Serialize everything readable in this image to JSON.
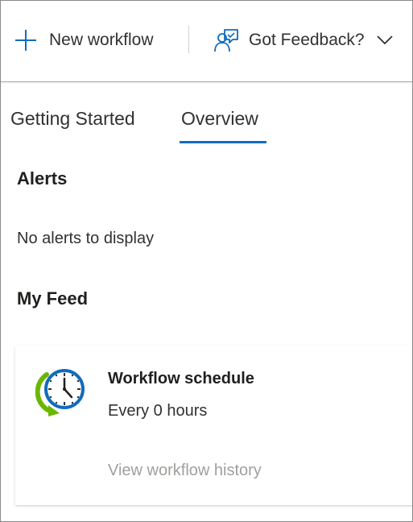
{
  "toolbar": {
    "new_workflow_label": "New workflow",
    "new_workflow_icon": "plus-icon",
    "feedback_label": "Got Feedback?",
    "feedback_icon": "feedback-person-icon",
    "feedback_chevron_icon": "chevron-down-icon"
  },
  "tabs": [
    {
      "label": "Getting Started",
      "selected": false
    },
    {
      "label": "Overview",
      "selected": true
    }
  ],
  "alerts": {
    "title": "Alerts",
    "empty_message": "No alerts to display"
  },
  "feed": {
    "title": "My Feed",
    "card": {
      "icon": "clock-refresh-icon",
      "title": "Workflow schedule",
      "subtitle": "Every 0 hours",
      "link_label": "View workflow history"
    }
  },
  "colors": {
    "accent": "#106ebe",
    "icon_blue": "#0f6cbd",
    "clock_green": "#6bb700",
    "muted_text": "#a19f9d",
    "border": "#8a8a8a"
  }
}
